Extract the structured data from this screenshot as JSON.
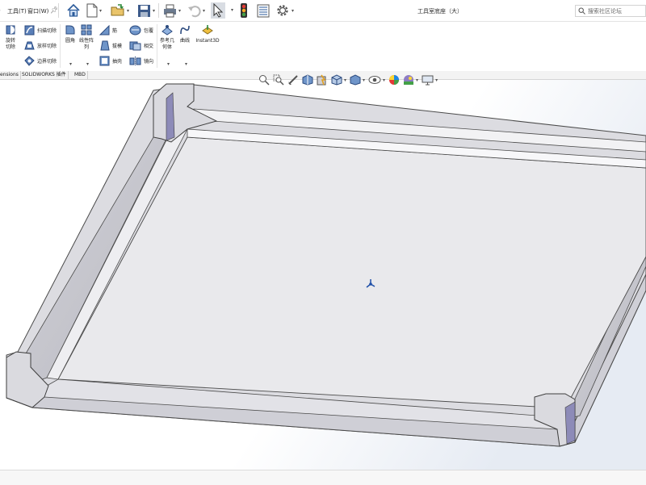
{
  "menubar": {
    "tools_label": "工具(T)",
    "window_label": "窗口(W)",
    "doc_title": "工具室底座（大）",
    "search_placeholder": "搜索社区论坛"
  },
  "ribbon": {
    "revolve_cut": "旋转切除",
    "swept_cut": "扫描切除",
    "lofted_cut": "放样切除",
    "boundary_cut": "边界切除",
    "fillet": "圆角",
    "linear_pattern": "线性阵列",
    "rib": "筋",
    "draft": "拔模",
    "shell": "抽壳",
    "wrap": "包覆",
    "intersect": "相交",
    "mirror": "镜向",
    "ref_geometry": "参考几何体",
    "curves": "曲线",
    "instant3d": "Instant3D"
  },
  "tabs": [
    {
      "label": "ensions"
    },
    {
      "label": "SOLIDWORKS 插件"
    },
    {
      "label": "MBD"
    }
  ],
  "colors": {
    "accent_blue": "#1f4fa8",
    "part_face": "#e9e9ec",
    "part_edge": "#4a4a4a"
  }
}
